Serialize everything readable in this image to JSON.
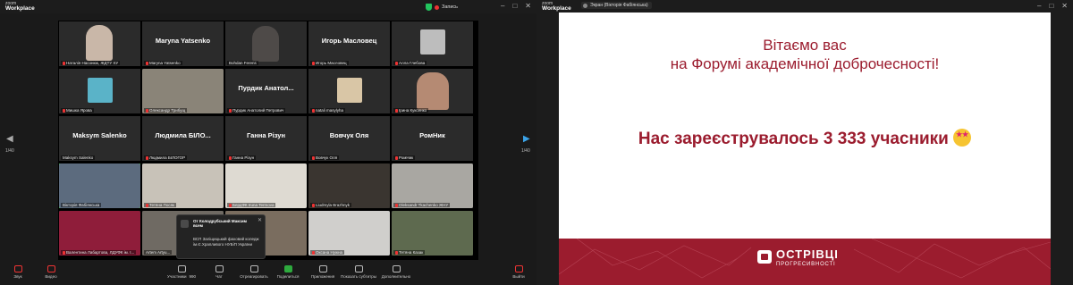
{
  "left_window": {
    "app_logo": {
      "top": "zoom",
      "bottom": "Workplace"
    },
    "recording_label": "Запись",
    "window_controls": [
      "–",
      "□",
      "✕"
    ],
    "page_indicator_left": "1/40",
    "page_indicator_right": "1/40",
    "tiles": [
      {
        "big": "",
        "name": "Наталія Насонюк, ЖДТУ ХУ"
      },
      {
        "big": "Maryna Yatsenko",
        "name": "Maryna Yatsenko"
      },
      {
        "big": "",
        "name": "Bohdan Ferens"
      },
      {
        "big": "Игорь Масловец",
        "name": "Игорь Масловец"
      },
      {
        "big": "",
        "name": "Алла Глебова"
      },
      {
        "big": "",
        "name": "Мишка Ярова"
      },
      {
        "big": "",
        "name": "Олександр Трибущ"
      },
      {
        "big": "Пурдик Анатол...",
        "name": "Пурдик Анатолий Петрович"
      },
      {
        "big": "",
        "name": "natali masylyha"
      },
      {
        "big": "",
        "name": "Ірина Куксенко"
      },
      {
        "big": "Maksym Salenko",
        "name": "Maksym Salenko"
      },
      {
        "big": "Людмила БІЛО...",
        "name": "Людмила БІЛОГОР"
      },
      {
        "big": "Ганна Різун",
        "name": "Ганна Різун"
      },
      {
        "big": "Вовчук Оля",
        "name": "Вовчук Оля"
      },
      {
        "big": "РомНик",
        "name": "РомНик"
      },
      {
        "big": "",
        "name": "Вікторія Фабіянська"
      },
      {
        "big": "",
        "name": "Тетяна Посяк"
      },
      {
        "big": "",
        "name": "БердФК Iruna Termova"
      },
      {
        "big": "",
        "name": "Liudmyla Brazhnyk"
      },
      {
        "big": "",
        "name": "Oleksandr Tkachenko ЖНУ"
      },
      {
        "big": "",
        "name": "Валентина Лабартова, ЛДУФК ім. І..."
      },
      {
        "big": "",
        "name": "Artem Artyu..."
      },
      {
        "big": "",
        "name": ""
      },
      {
        "big": "",
        "name": "Оксана Нужна"
      },
      {
        "big": "",
        "name": "Тетяна Казак"
      }
    ],
    "chat_popup": {
      "from": "От Колодрубський Максим всем",
      "message": "ВСП Заліщицький фаховий коледж ім.Є.Храпливого НУБіП України",
      "close": "✕"
    },
    "toolbar": {
      "audio": "Звук",
      "video": "Видео",
      "participants": "Участники",
      "participants_count": "990",
      "chat": "Чат",
      "react": "Отреагировать",
      "share": "Поделиться",
      "apps": "Приложения",
      "captions": "Показать субтитры",
      "more": "Дополнительно",
      "leave": "Выйти"
    }
  },
  "right_window": {
    "app_logo": {
      "top": "zoom",
      "bottom": "Workplace"
    },
    "share_title": "Экран (Вікторія Фабіянська)",
    "window_controls": [
      "–",
      "□",
      "✕"
    ],
    "slide": {
      "line1": "Вітаємо вас",
      "line2": "на Форумі академічної доброчесності!",
      "line3": "Нас зареєструвалось 3 333 учасники",
      "brand_top": "ОСТРІВЦІ",
      "brand_bottom": "ПРОГРЕСИВНОСТІ",
      "accent_color": "#9b1c2e"
    }
  }
}
